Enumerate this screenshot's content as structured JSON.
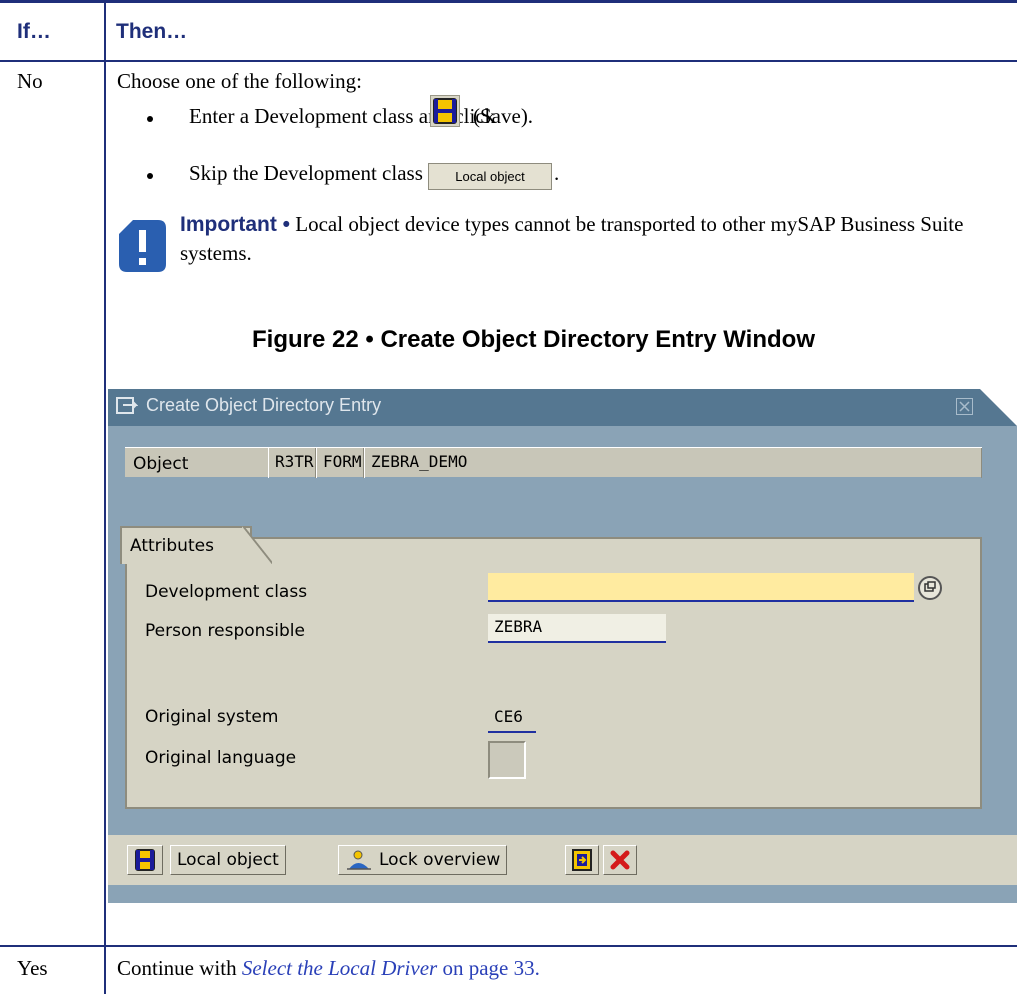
{
  "table": {
    "col_if": "If…",
    "col_then": "Then…",
    "row_no": {
      "if": "No",
      "intro": "Choose one of the following:",
      "bullet1_before": "Enter a Development class and click",
      "bullet1_after": "(Save).",
      "bullet2_before": "Skip the Development class and click",
      "bullet2_button": "Local object",
      "bullet2_after": ".",
      "important_label": "Important •",
      "important_text": "Local object device types cannot be transported to other mySAP Business Suite systems."
    },
    "caption": "Figure 22 • Create Object Directory Entry Window",
    "row_yes": {
      "if": "Yes",
      "text_before": "Continue with",
      "link": "Select the Local Driver",
      "text_after": "on page 33."
    }
  },
  "dialog": {
    "title": "Create Object Directory Entry",
    "object_label": "Object",
    "object_parts": [
      "R3TR",
      "FORM",
      "ZEBRA_DEMO"
    ],
    "group_title": "Attributes",
    "fields": {
      "development_class_label": "Development class",
      "development_class_value": "",
      "person_label": "Person responsible",
      "person_value": "ZEBRA",
      "orig_system_label": "Original system",
      "orig_system_value": "CE6",
      "orig_language_label": "Original language",
      "orig_language_value": ""
    },
    "toolbar": {
      "local_object": "Local object",
      "lock_overview": "Lock overview"
    }
  },
  "colors": {
    "header_blue": "#1f2f7a",
    "sap_frame": "#8aa3b6",
    "sap_title": "#557791",
    "sap_panel": "#d6d4c5",
    "required_field": "#ffeba0"
  }
}
